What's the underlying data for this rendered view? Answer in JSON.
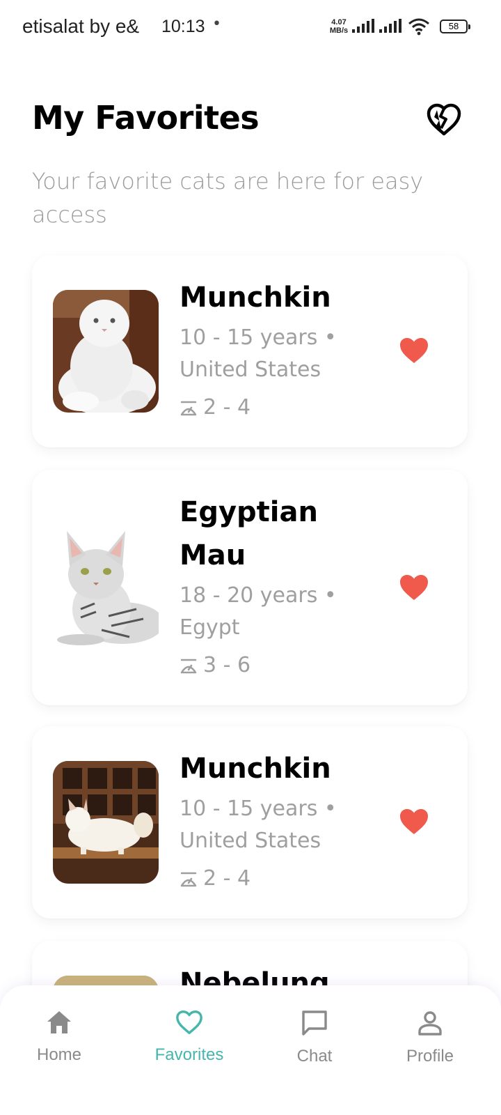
{
  "status_bar": {
    "carrier": "etisalat by e&",
    "time": "10:13",
    "dot": "•",
    "net_speed_value": "4.07",
    "net_speed_unit": "MB/s",
    "battery": "58"
  },
  "header": {
    "title": "My Favorites",
    "subtitle": "Your favorite cats are here for easy access",
    "action_icon": "broken-heart-icon"
  },
  "favorites": [
    {
      "name": "Munchkin",
      "lifespan": "10 - 15 years •",
      "origin": "United States",
      "weight": "2 - 4",
      "favorite": true
    },
    {
      "name": "Egyptian Mau",
      "lifespan": "18 - 20 years •",
      "origin": "Egypt",
      "weight": "3 - 6",
      "favorite": true
    },
    {
      "name": "Munchkin",
      "lifespan": "10 - 15 years •",
      "origin": "United States",
      "weight": "2 - 4",
      "favorite": true
    },
    {
      "name": "Nebelung",
      "favorite": true
    }
  ],
  "bottom_nav": {
    "items": [
      {
        "label": "Home",
        "icon": "home-icon"
      },
      {
        "label": "Favorites",
        "icon": "heart-outline-icon"
      },
      {
        "label": "Chat",
        "icon": "chat-icon"
      },
      {
        "label": "Profile",
        "icon": "profile-icon"
      }
    ],
    "active": "Favorites"
  },
  "colors": {
    "accent": "#46b6ad",
    "favorite_heart": "#ef5a4c",
    "muted_text": "#9f9f9f"
  }
}
